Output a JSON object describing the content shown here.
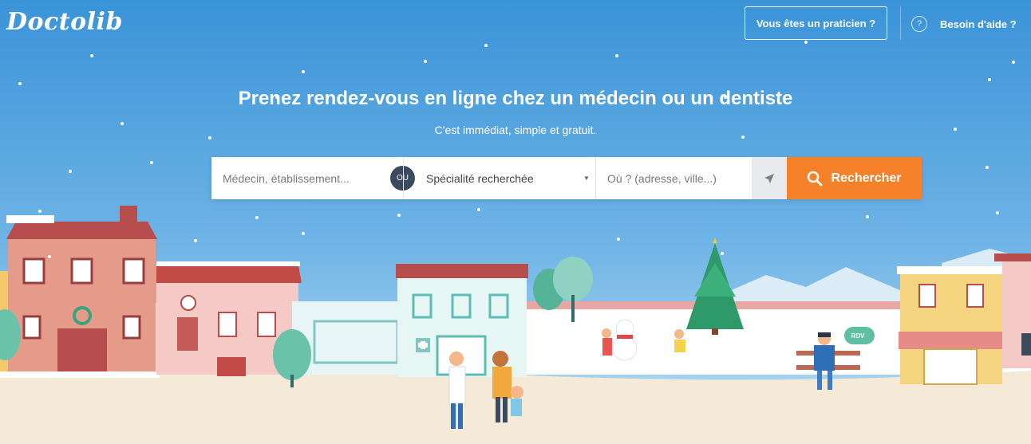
{
  "header": {
    "logo_text": "Doctolib",
    "pro_button_label": "Vous êtes un praticien ?",
    "help_icon_glyph": "?",
    "help_label": "Besoin d'aide ?"
  },
  "hero": {
    "title": "Prenez rendez-vous en ligne chez un médecin ou un dentiste",
    "subtitle": "C'est immédiat, simple et gratuit."
  },
  "search": {
    "name_placeholder": "Médecin, établissement...",
    "or_label": "OU",
    "specialty_value": "Spécialité recherchée",
    "location_placeholder": "Où ? (adresse, ville...)",
    "submit_label": "Rechercher",
    "geolocate_icon": "location-arrow-icon",
    "search_icon": "magnifier-icon"
  },
  "illustration": {
    "rdv_badge": "RDV"
  },
  "colors": {
    "sky_top": "#3a93d8",
    "sky_bottom": "#a9d3ee",
    "accent": "#f5822a",
    "ground": "#f4ead7"
  }
}
